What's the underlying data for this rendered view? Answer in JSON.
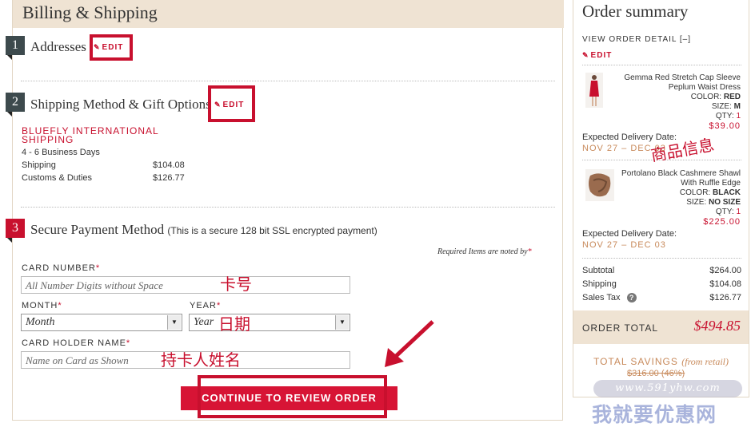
{
  "billing": {
    "title": "Billing & Shipping",
    "steps": [
      {
        "number": "1",
        "title": "Addresses",
        "edit": "EDIT"
      },
      {
        "number": "2",
        "title": "Shipping Method & Gift Options",
        "edit": "EDIT"
      },
      {
        "number": "3",
        "title": "Secure Payment Method",
        "subtitle": "(This is a secure 128 bit SSL encrypted payment)"
      }
    ],
    "shipping": {
      "method_line1": "BLUEFLY INTERNATIONAL",
      "method_line2": "SHIPPING",
      "days": "4 - 6 Business Days",
      "rows": [
        {
          "label": "Shipping",
          "value": "$104.08"
        },
        {
          "label": "Customs & Duties",
          "value": "$126.77"
        }
      ]
    }
  },
  "payment": {
    "required_note": "Required Items are noted by",
    "required_star": "*",
    "card_number_label": "CARD NUMBER",
    "card_number_placeholder": "All Number Digits without Space",
    "month_label": "MONTH",
    "month_value": "Month",
    "year_label": "YEAR",
    "year_value": "Year",
    "holder_label": "CARD HOLDER NAME",
    "holder_placeholder": "Name on Card as Shown",
    "submit_label": "CONTINUE TO REVIEW ORDER"
  },
  "annotations": {
    "card_number": "卡号",
    "date": "日期",
    "holder": "持卡人姓名",
    "product_info": "商品信息",
    "watermark_url": "www.591yhw.com",
    "watermark_name": "我就要优惠网"
  },
  "summary": {
    "title": "Order summary",
    "view_detail": "VIEW ORDER DETAIL [–]",
    "edit": "EDIT",
    "items": [
      {
        "name_line1": "Gemma Red Stretch Cap Sleeve",
        "name_line2": "Peplum Waist Dress",
        "color_label": "COLOR:",
        "color": "RED",
        "size_label": "SIZE:",
        "size": "M",
        "qty_label": "QTY:",
        "qty": "1",
        "price": "$39.00",
        "delivery_label": "Expected Delivery Date:",
        "delivery": "NOV 27 – DEC 03"
      },
      {
        "name_line1": "Portolano Black Cashmere Shawl",
        "name_line2": "With Ruffle Edge",
        "color_label": "COLOR:",
        "color": "BLACK",
        "size_label": "SIZE:",
        "size": "NO SIZE",
        "qty_label": "QTY:",
        "qty": "1",
        "price": "$225.00",
        "delivery_label": "Expected Delivery Date:",
        "delivery": "NOV 27 – DEC 03"
      }
    ],
    "subtotal_label": "Subtotal",
    "subtotal": "$264.00",
    "shipping_label": "Shipping",
    "shipping": "$104.08",
    "tax_label": "Sales Tax",
    "tax": "$126.77",
    "order_total_label": "ORDER TOTAL",
    "order_total": "$494.85",
    "savings_label": "TOTAL SAVINGS",
    "savings_note": "(from retail)",
    "savings_value": "$316.00 (46%)"
  },
  "colors": {
    "accent": "#c8102e",
    "band": "#efe3d3",
    "delivery": "#c88a5b"
  }
}
